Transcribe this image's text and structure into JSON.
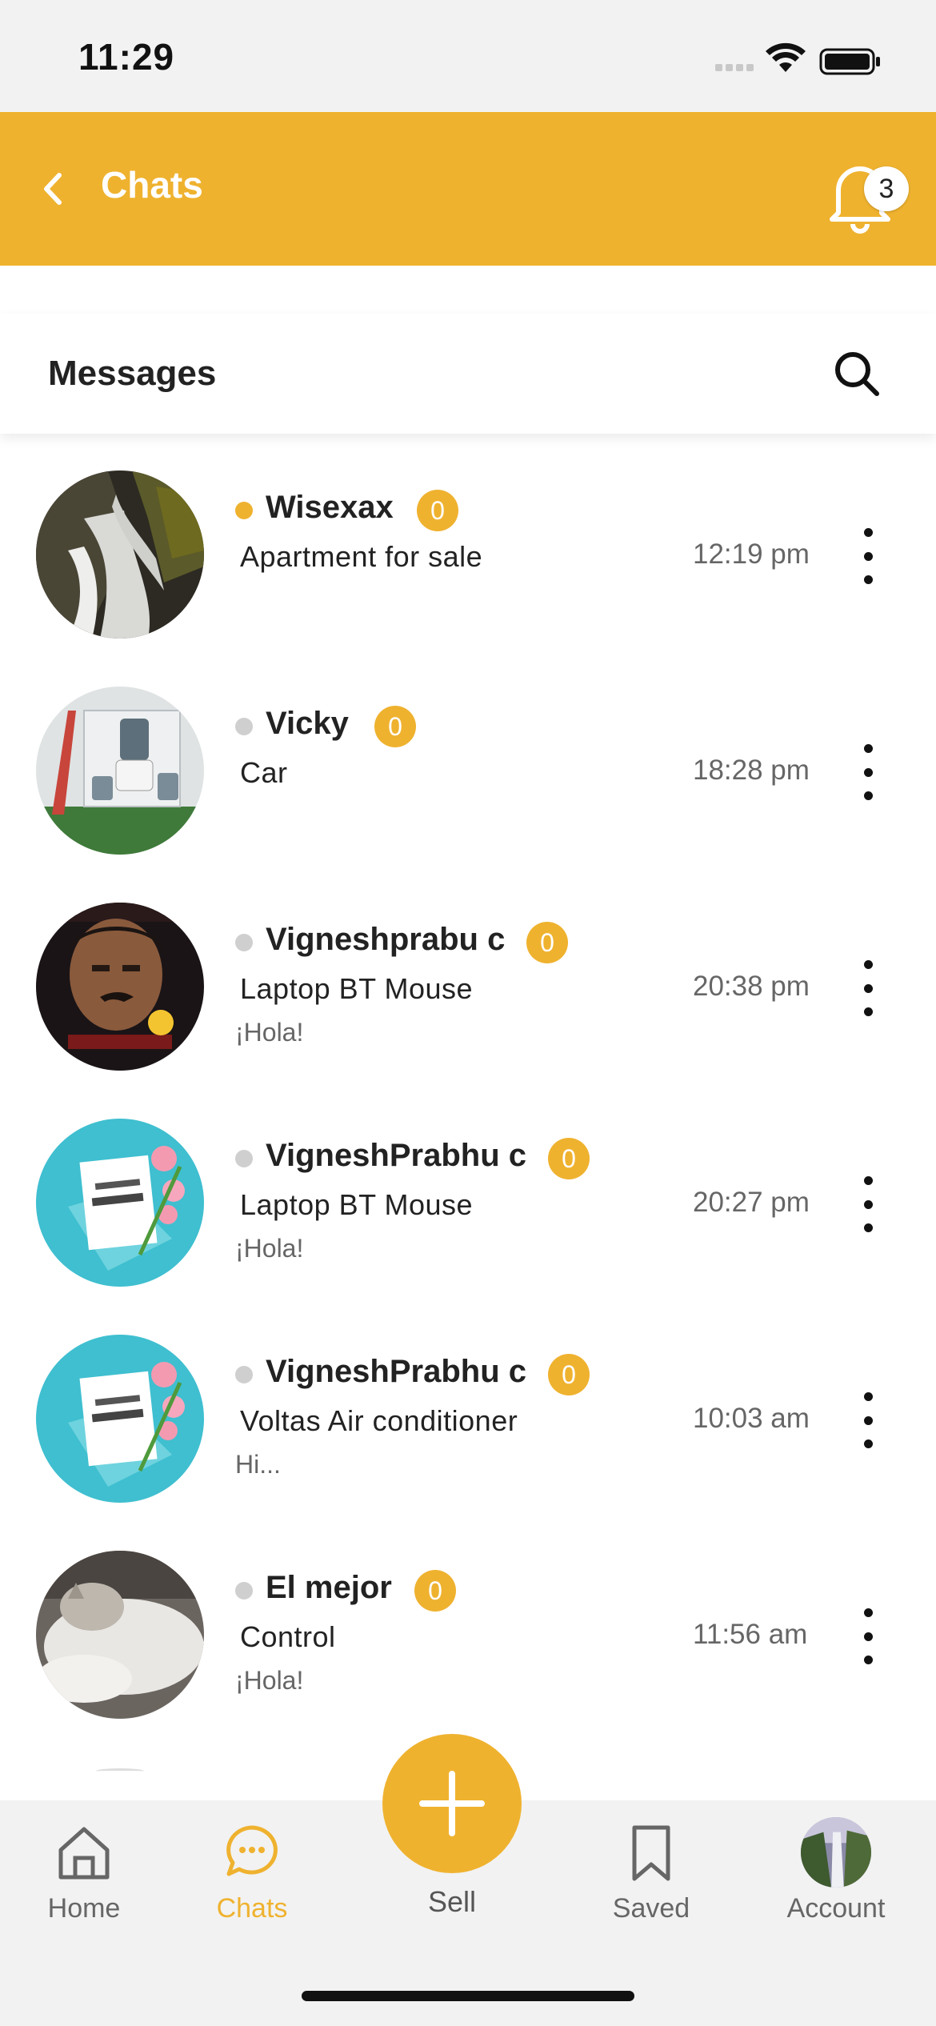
{
  "status_bar": {
    "time": "11:29"
  },
  "header": {
    "title": "Chats",
    "notification_count": "3"
  },
  "messages_bar": {
    "title": "Messages"
  },
  "chats": [
    {
      "name": "Wisexax",
      "unread": "0",
      "item_title": "Apartment for sale",
      "preview": "",
      "time": "12:19 pm",
      "online": true,
      "avatar": "waterfall-rocks"
    },
    {
      "name": "Vicky",
      "unread": "0",
      "item_title": "Car",
      "preview": "",
      "time": "18:28 pm",
      "online": false,
      "avatar": "mixer-grinder"
    },
    {
      "name": "Vigneshprabu c",
      "unread": "0",
      "item_title": "Laptop BT Mouse",
      "preview": "¡Hola!",
      "time": "20:38 pm",
      "online": false,
      "avatar": "meme-face"
    },
    {
      "name": "VigneshPrabhu c",
      "unread": "0",
      "item_title": "Laptop BT Mouse",
      "preview": "¡Hola!",
      "time": "20:27 pm",
      "online": false,
      "avatar": "mothers-day-card"
    },
    {
      "name": "VigneshPrabhu c",
      "unread": "0",
      "item_title": "Voltas Air conditioner",
      "preview": "Hi...",
      "time": "10:03 am",
      "online": false,
      "avatar": "mothers-day-card"
    },
    {
      "name": "El mejor",
      "unread": "0",
      "item_title": "Control",
      "preview": "¡Hola!",
      "time": "11:56 am",
      "online": false,
      "avatar": "cat"
    }
  ],
  "bottom_nav": {
    "home": "Home",
    "chats": "Chats",
    "sell": "Sell",
    "saved": "Saved",
    "account": "Account",
    "active": "chats"
  },
  "colors": {
    "accent": "#efb22f",
    "online": "#efb22f",
    "offline": "#cfcfcf"
  }
}
